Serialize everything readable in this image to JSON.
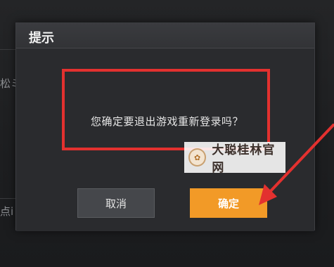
{
  "background": {
    "fragment_top": "松ミ",
    "fragment_bottom": "点i"
  },
  "dialog": {
    "title": "提示",
    "message": "您确定要退出游戏重新登录吗？",
    "cancel_label": "取消",
    "confirm_label": "确定"
  },
  "annotation": {
    "highlight_color": "#e3312f",
    "arrow_color": "#e3312f"
  },
  "watermark": {
    "text": "大聪桂林官网"
  },
  "colors": {
    "confirm_button": "#f29a27",
    "cancel_button": "#45474b",
    "dialog_bg": "#2a2b2e"
  }
}
